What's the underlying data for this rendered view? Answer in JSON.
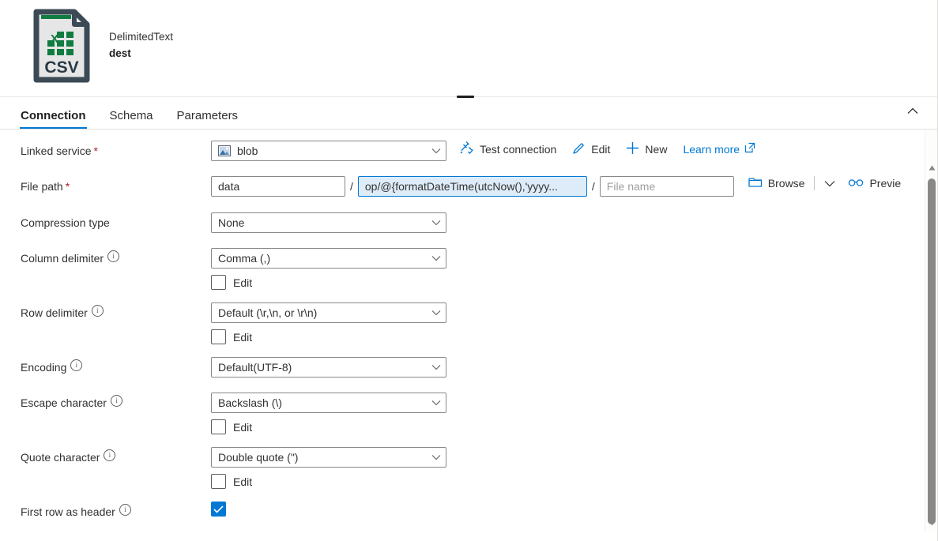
{
  "header": {
    "icon": "csv-file-icon",
    "dataset_type": "DelimitedText",
    "dataset_name": "dest"
  },
  "tabs": [
    {
      "label": "Connection",
      "active": true
    },
    {
      "label": "Schema",
      "active": false
    },
    {
      "label": "Parameters",
      "active": false
    }
  ],
  "collapse_icon": "chevron-up-icon",
  "form": {
    "linked_service": {
      "label": "Linked service",
      "required": "*",
      "value": "blob",
      "icon": "blob-storage-icon",
      "actions": {
        "test_connection": "Test connection",
        "edit": "Edit",
        "new": "New",
        "learn_more": "Learn more"
      }
    },
    "file_path": {
      "label": "File path",
      "required": "*",
      "container_value": "data",
      "directory_value": "op/@{formatDateTime(utcNow(),'yyyy...",
      "file_name_placeholder": "File name",
      "separator": "/",
      "browse_label": "Browse",
      "preview_label": "Previe"
    },
    "compression_type": {
      "label": "Compression type",
      "value": "None"
    },
    "column_delimiter": {
      "label": "Column delimiter",
      "value": "Comma (,)",
      "edit_label": "Edit",
      "edit_checked": false
    },
    "row_delimiter": {
      "label": "Row delimiter",
      "value": "Default (\\r,\\n, or \\r\\n)",
      "edit_label": "Edit",
      "edit_checked": false
    },
    "encoding": {
      "label": "Encoding",
      "value": "Default(UTF-8)"
    },
    "escape_character": {
      "label": "Escape character",
      "value": "Backslash (\\)",
      "edit_label": "Edit",
      "edit_checked": false
    },
    "quote_character": {
      "label": "Quote character",
      "value": "Double quote (\")",
      "edit_label": "Edit",
      "edit_checked": false
    },
    "first_row_as_header": {
      "label": "First row as header",
      "checked": true
    }
  },
  "colors": {
    "accent": "#0078d4",
    "required": "#a4262c",
    "csv_green": "#107c41",
    "csv_border": "#3b4a54"
  }
}
